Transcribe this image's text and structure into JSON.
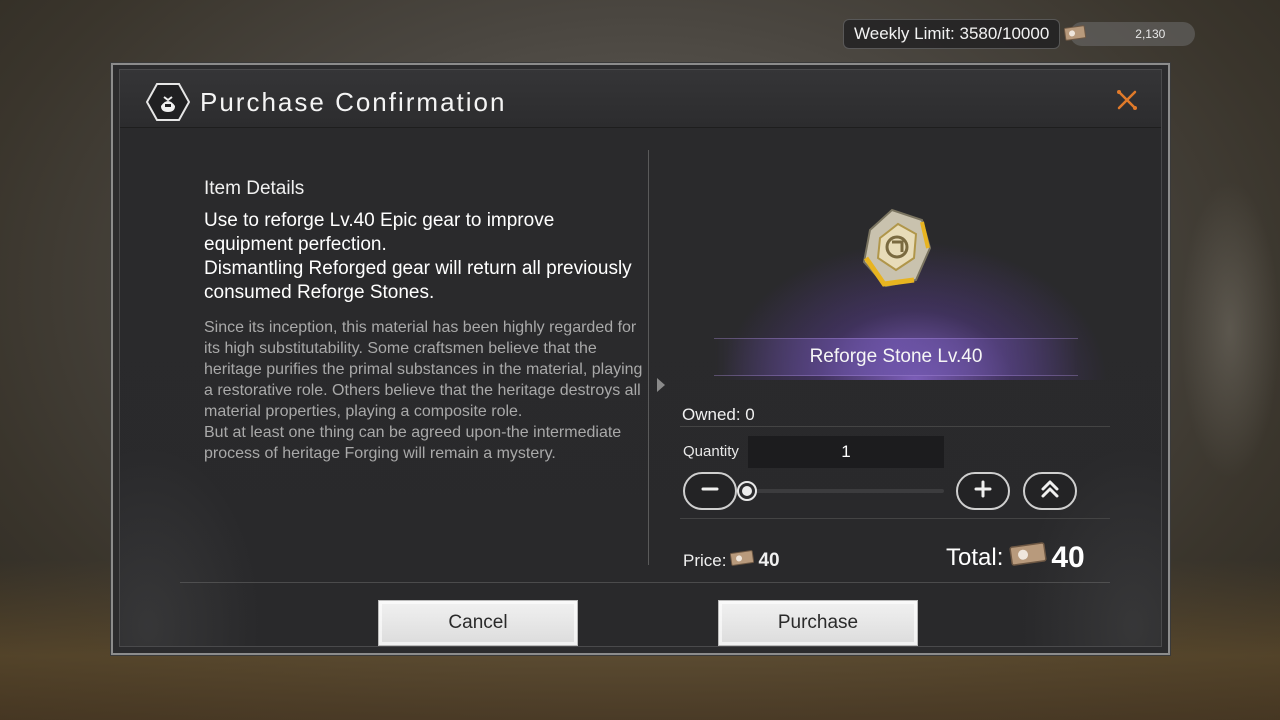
{
  "topbar": {
    "weekly_limit": "Weekly Limit: 3580/10000",
    "currency_icon": "ticket-icon",
    "currency_amount": "2,130"
  },
  "dialog": {
    "title": "Purchase Confirmation",
    "title_icon": "bag-icon",
    "close_icon": "close-icon"
  },
  "details": {
    "header": "Item Details",
    "description": [
      "Use to reforge Lv.40 Epic gear to improve equipment perfection.",
      "Dismantling Reforged gear will return all previously consumed Reforge Stones."
    ],
    "lore": [
      "Since its inception, this material has been highly regarded for its high substitutability. Some craftsmen believe that the heritage purifies the primal substances in the material, playing a restorative role. Others believe that the heritage destroys all material properties, playing a composite role.",
      "But at least one thing can be agreed upon-the intermediate process of heritage Forging will remain a mystery."
    ]
  },
  "item": {
    "name": "Reforge Stone Lv.40",
    "icon": "reforge-stone-icon",
    "rarity_color": "#8a6ad0"
  },
  "purchase": {
    "owned": "Owned: 0",
    "quantity_label": "Quantity",
    "quantity_value": "1",
    "quantity_slider_fraction": 0,
    "price_label": "Price:",
    "price_value": "40",
    "total_label": "Total:",
    "total_value": "40"
  },
  "buttons": {
    "cancel": "Cancel",
    "purchase": "Purchase"
  }
}
